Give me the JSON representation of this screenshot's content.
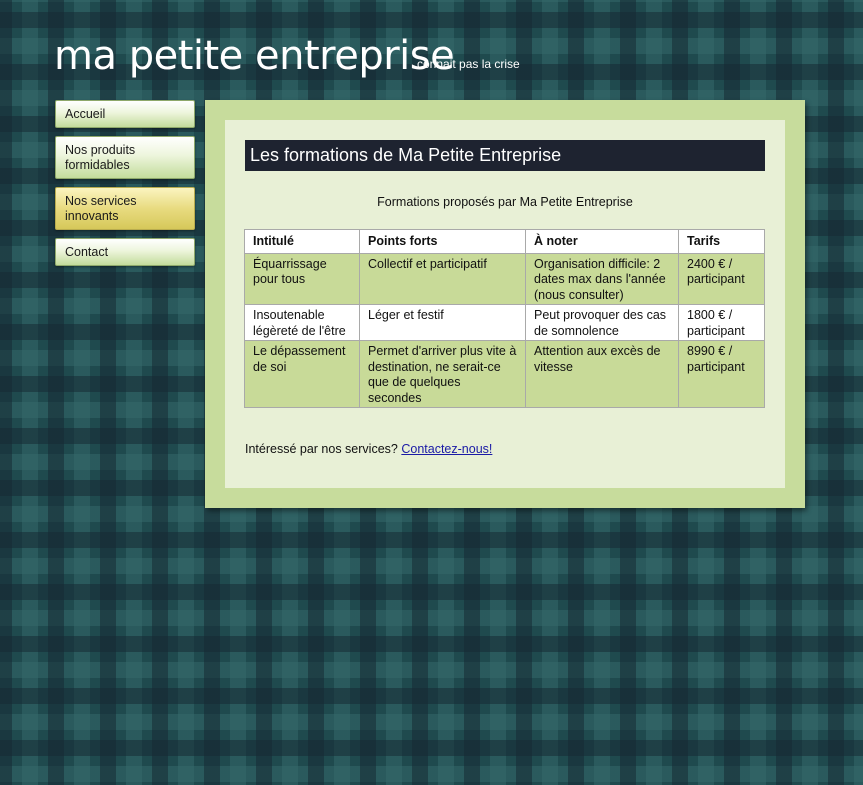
{
  "header": {
    "site_title": "ma petite entreprise",
    "tagline": "connait pas la crise"
  },
  "menu": {
    "items": [
      {
        "label": "Accueil",
        "active": false
      },
      {
        "label": "Nos produits formidables",
        "active": false
      },
      {
        "label": "Nos services innovants",
        "active": true
      },
      {
        "label": "Contact",
        "active": false
      }
    ]
  },
  "content": {
    "title": "Les formations de Ma Petite Entreprise",
    "table_caption": "Formations proposés par Ma Petite Entreprise",
    "table": {
      "headers": [
        "Intitulé",
        "Points forts",
        "À noter",
        "Tarifs"
      ],
      "rows": [
        [
          "Équarrissage pour tous",
          "Collectif et participatif",
          "Organisation difficile: 2 dates max dans l'année (nous consulter)",
          "2400 € / participant"
        ],
        [
          "Insoutenable légèreté de l'être",
          "Léger et festif",
          "Peut provoquer des cas de somnolence",
          "1800 € / participant"
        ],
        [
          "Le dépassement de soi",
          "Permet d'arriver plus vite à destination, ne serait-ce que de quelques secondes",
          "Attention aux excès de vitesse",
          "8990 € / participant"
        ]
      ]
    },
    "contact_prompt": "Intéressé par nos services?",
    "contact_link": "Contactez-nous!"
  },
  "colors": {
    "menu_active": "#e8db80",
    "panel_outer": "#c7dc9c",
    "panel_inner": "#e8f0d6",
    "title_bar": "#1e2330",
    "row_highlight": "#c8da98",
    "link": "#1a1aa6"
  }
}
